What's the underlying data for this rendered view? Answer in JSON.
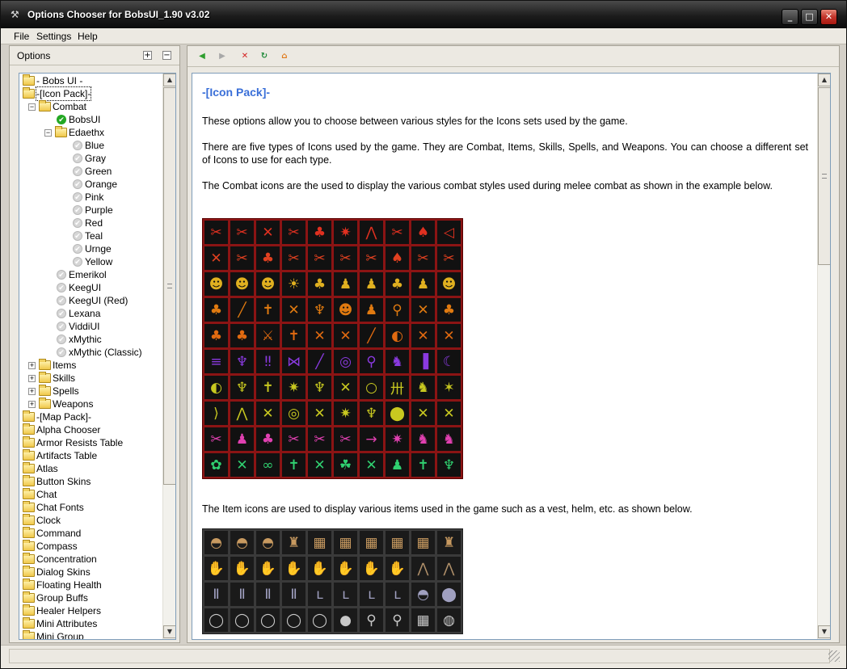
{
  "window": {
    "title": "Options Chooser for BobsUI_1.90 v3.02"
  },
  "menu": [
    "File",
    "Settings",
    "Help"
  ],
  "left_panel": {
    "header": "Options",
    "expand_label": "+",
    "collapse_label": "−"
  },
  "tree": [
    {
      "label": "- Bobs UI -",
      "level": 0,
      "icon": "folder-icon",
      "expander": ""
    },
    {
      "label": "-[Icon Pack]-",
      "level": 0,
      "icon": "folder-open-icon",
      "expander": "",
      "selected": true
    },
    {
      "label": "Combat",
      "level": 1,
      "icon": "folder-open-icon",
      "expander": "−"
    },
    {
      "label": "BobsUI",
      "level": 2,
      "icon": "checked-icon",
      "expander": ""
    },
    {
      "label": "Edaethx",
      "level": 2,
      "icon": "folder-open-icon",
      "expander": "−"
    },
    {
      "label": "Blue",
      "level": 3,
      "icon": "unchecked-icon",
      "expander": ""
    },
    {
      "label": "Gray",
      "level": 3,
      "icon": "unchecked-icon",
      "expander": ""
    },
    {
      "label": "Green",
      "level": 3,
      "icon": "unchecked-icon",
      "expander": ""
    },
    {
      "label": "Orange",
      "level": 3,
      "icon": "unchecked-icon",
      "expander": ""
    },
    {
      "label": "Pink",
      "level": 3,
      "icon": "unchecked-icon",
      "expander": ""
    },
    {
      "label": "Purple",
      "level": 3,
      "icon": "unchecked-icon",
      "expander": ""
    },
    {
      "label": "Red",
      "level": 3,
      "icon": "unchecked-icon",
      "expander": ""
    },
    {
      "label": "Teal",
      "level": 3,
      "icon": "unchecked-icon",
      "expander": ""
    },
    {
      "label": "Urnge",
      "level": 3,
      "icon": "unchecked-icon",
      "expander": ""
    },
    {
      "label": "Yellow",
      "level": 3,
      "icon": "unchecked-icon",
      "expander": ""
    },
    {
      "label": "Emerikol",
      "level": 2,
      "icon": "unchecked-icon",
      "expander": ""
    },
    {
      "label": "KeegUI",
      "level": 2,
      "icon": "unchecked-icon",
      "expander": ""
    },
    {
      "label": "KeegUI (Red)",
      "level": 2,
      "icon": "unchecked-icon",
      "expander": ""
    },
    {
      "label": "Lexana",
      "level": 2,
      "icon": "unchecked-icon",
      "expander": ""
    },
    {
      "label": "ViddiUI",
      "level": 2,
      "icon": "unchecked-icon",
      "expander": ""
    },
    {
      "label": "xMythic",
      "level": 2,
      "icon": "unchecked-icon",
      "expander": ""
    },
    {
      "label": "xMythic (Classic)",
      "level": 2,
      "icon": "unchecked-icon",
      "expander": ""
    },
    {
      "label": "Items",
      "level": 1,
      "icon": "folder-icon",
      "expander": "+"
    },
    {
      "label": "Skills",
      "level": 1,
      "icon": "folder-icon",
      "expander": "+"
    },
    {
      "label": "Spells",
      "level": 1,
      "icon": "folder-icon",
      "expander": "+"
    },
    {
      "label": "Weapons",
      "level": 1,
      "icon": "folder-icon",
      "expander": "+"
    },
    {
      "label": "-[Map Pack]-",
      "level": 0,
      "icon": "folder-icon",
      "expander": ""
    },
    {
      "label": "Alpha Chooser",
      "level": 0,
      "icon": "folder-icon",
      "expander": ""
    },
    {
      "label": "Armor Resists Table",
      "level": 0,
      "icon": "folder-icon",
      "expander": ""
    },
    {
      "label": "Artifacts Table",
      "level": 0,
      "icon": "folder-icon",
      "expander": ""
    },
    {
      "label": "Atlas",
      "level": 0,
      "icon": "folder-icon",
      "expander": ""
    },
    {
      "label": "Button Skins",
      "level": 0,
      "icon": "folder-icon",
      "expander": ""
    },
    {
      "label": "Chat",
      "level": 0,
      "icon": "folder-icon",
      "expander": ""
    },
    {
      "label": "Chat Fonts",
      "level": 0,
      "icon": "folder-icon",
      "expander": ""
    },
    {
      "label": "Clock",
      "level": 0,
      "icon": "folder-icon",
      "expander": ""
    },
    {
      "label": "Command",
      "level": 0,
      "icon": "folder-icon",
      "expander": ""
    },
    {
      "label": "Compass",
      "level": 0,
      "icon": "folder-icon",
      "expander": ""
    },
    {
      "label": "Concentration",
      "level": 0,
      "icon": "folder-icon",
      "expander": ""
    },
    {
      "label": "Dialog Skins",
      "level": 0,
      "icon": "folder-icon",
      "expander": ""
    },
    {
      "label": "Floating Health",
      "level": 0,
      "icon": "folder-icon",
      "expander": ""
    },
    {
      "label": "Group Buffs",
      "level": 0,
      "icon": "folder-icon",
      "expander": ""
    },
    {
      "label": "Healer Helpers",
      "level": 0,
      "icon": "folder-icon",
      "expander": ""
    },
    {
      "label": "Mini Attributes",
      "level": 0,
      "icon": "folder-icon",
      "expander": ""
    },
    {
      "label": "Mini Group",
      "level": 0,
      "icon": "folder-icon",
      "expander": ""
    }
  ],
  "toolbar": [
    {
      "name": "back-button",
      "icon": "back-arrow-icon",
      "glyph": "◀",
      "color": "#2f9e2f"
    },
    {
      "name": "forward-button",
      "icon": "forward-arrow-icon",
      "glyph": "▶",
      "color": "#a8a8a8"
    },
    {
      "name": "stop-button",
      "icon": "stop-icon",
      "glyph": "✕",
      "color": "#d42020"
    },
    {
      "name": "refresh-button",
      "icon": "refresh-icon",
      "glyph": "↻",
      "color": "#1f8a3a"
    },
    {
      "name": "home-button",
      "icon": "home-icon",
      "glyph": "⌂",
      "color": "#e07a1a"
    }
  ],
  "content": {
    "heading": "-[Icon Pack]-",
    "paragraphs": [
      "These options allow you to choose between various styles for the Icons sets used by the game.",
      "There are five types of Icons used by the game.  They are Combat, Items, Skills, Spells, and Weapons.  You can choose a different set of Icons to use for each type.",
      "The Combat icons are the used to display the various combat styles used during melee combat as shown in the example below.",
      "The Item icons are used to display various items used in the game such as a vest, helm, etc. as shown below."
    ],
    "combat_grid": {
      "rows": [
        {
          "color": "#e03020",
          "glyphs": [
            "✂",
            "✂",
            "✕",
            "✂",
            "♣",
            "✷",
            "⋀",
            "✂",
            "♠",
            "◁"
          ]
        },
        {
          "color": "#e04020",
          "glyphs": [
            "✕",
            "✂",
            "♣",
            "✂",
            "✂",
            "✂",
            "✂",
            "♠",
            "✂",
            "✂"
          ]
        },
        {
          "color": "#e0b020",
          "glyphs": [
            "☻",
            "☻",
            "☻",
            "☀",
            "♣",
            "♟",
            "♟",
            "♣",
            "♟",
            "☻"
          ]
        },
        {
          "color": "#e07a10",
          "glyphs": [
            "♣",
            "╱",
            "✝",
            "✕",
            "♆",
            "☻",
            "♟",
            "⚲",
            "✕",
            "♣"
          ]
        },
        {
          "color": "#e06a10",
          "glyphs": [
            "♣",
            "♣",
            "⚔",
            "✝",
            "✕",
            "✕",
            "╱",
            "◐",
            "✕",
            "✕"
          ]
        },
        {
          "color": "#8a3ae0",
          "glyphs": [
            "≡",
            "♆",
            "‼",
            "⋈",
            "╱",
            "◎",
            "⚲",
            "♞",
            "▐",
            "☾"
          ]
        },
        {
          "color": "#c8c820",
          "glyphs": [
            "◐",
            "♆",
            "✝",
            "✷",
            "♆",
            "✕",
            "○",
            "卅",
            "♞",
            "✶"
          ]
        },
        {
          "color": "#c8c820",
          "glyphs": [
            "⟩",
            "⋀",
            "✕",
            "◎",
            "✕",
            "✷",
            "♆",
            "⬤",
            "✕",
            "✕"
          ]
        },
        {
          "color": "#e040b0",
          "glyphs": [
            "✂",
            "♟",
            "♣",
            "✂",
            "✂",
            "✂",
            "→",
            "✷",
            "♞",
            "♞"
          ]
        },
        {
          "color": "#30d070",
          "glyphs": [
            "✿",
            "✕",
            "∞",
            "✝",
            "✕",
            "☘",
            "✕",
            "♟",
            "✝",
            "♆"
          ]
        }
      ]
    },
    "items_grid": {
      "rows": [
        {
          "color": "#c89a60",
          "glyphs": [
            "◓",
            "◓",
            "◓",
            "♜",
            "▦",
            "▦",
            "▦",
            "▦",
            "▦",
            "♜"
          ]
        },
        {
          "color": "#b0906a",
          "glyphs": [
            "✋",
            "✋",
            "✋",
            "✋",
            "✋",
            "✋",
            "✋",
            "✋",
            "⋀",
            "⋀"
          ]
        },
        {
          "color": "#a0a0c0",
          "glyphs": [
            "Ⅱ",
            "Ⅱ",
            "Ⅱ",
            "Ⅱ",
            "ʟ",
            "ʟ",
            "ʟ",
            "ʟ",
            "◓",
            "⬤"
          ]
        },
        {
          "color": "#c8c8c8",
          "glyphs": [
            "◯",
            "◯",
            "◯",
            "◯",
            "◯",
            "●",
            "⚲",
            "⚲",
            "▦",
            "◍"
          ]
        }
      ]
    }
  },
  "statusbar": {
    "text": ""
  }
}
